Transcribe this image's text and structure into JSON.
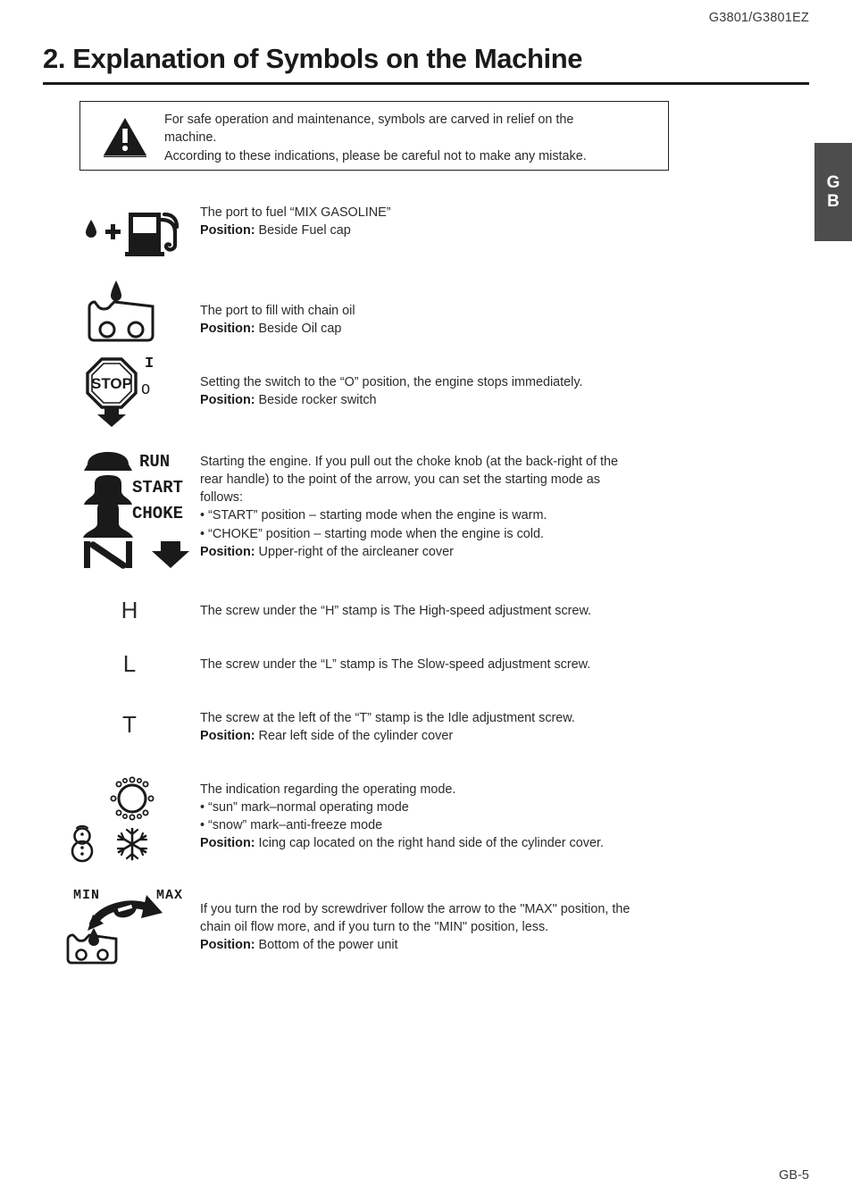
{
  "header": {
    "model_code": "G3801/G3801EZ",
    "title": "2. Explanation of Symbols on the Machine"
  },
  "side_tab": {
    "line1": "G",
    "line2": "B"
  },
  "note": {
    "icon": "warning-triangle-icon",
    "line1": "For safe operation and maintenance, symbols are carved in relief on the",
    "line2": "machine.",
    "line3": "According to these indications, please be careful not to make any mistake."
  },
  "rows": [
    {
      "icon": "fuel-pump-icon",
      "line1": "The port to fuel “MIX GASOLINE”",
      "position_label": "Position:",
      "position_value": " Beside Fuel cap"
    },
    {
      "icon": "chain-oil-icon",
      "line1": "The port to fill with chain oil",
      "position_label": "Position:",
      "position_value": " Beside Oil cap"
    },
    {
      "icon": "stop-switch-icon",
      "switch_on": "I",
      "switch_off": "O",
      "line1": "Setting the switch to the “O” position, the engine stops immediately.",
      "position_label": "Position:",
      "position_value": " Beside rocker switch"
    },
    {
      "icon": "choke-knob-icon",
      "knob_labels": [
        "RUN",
        "START",
        "CHOKE"
      ],
      "line1": "Starting the engine. If you pull out the choke knob (at the back-right of the",
      "line2": "rear handle) to the point of the arrow, you can set the starting mode as",
      "line3": "follows:",
      "bullet1": "• “START” position – starting mode when the engine is warm.",
      "bullet2": "• “CHOKE” position – starting mode when the engine is cold.",
      "position_label": "Position:",
      "position_value": " Upper-right of the aircleaner cover"
    },
    {
      "icon": "letter-h-stamp",
      "letter": "H",
      "line1": "The screw under the “H” stamp is The High-speed adjustment screw."
    },
    {
      "icon": "letter-l-stamp",
      "letter": "L",
      "line1": "The screw under the “L” stamp is The Slow-speed adjustment screw."
    },
    {
      "icon": "letter-t-stamp",
      "letter": "T",
      "line1": "The screw at the left of the “T” stamp is the Idle adjustment screw.",
      "position_label": "Position:",
      "position_value": " Rear left side of the cylinder cover"
    },
    {
      "icon": "sun-snow-icon",
      "line1": "The indication regarding the operating mode.",
      "bullet1": "• “sun” mark–normal operating mode",
      "bullet2": "• “snow” mark–anti-freeze mode",
      "position_label": "Position:",
      "position_value": " Icing cap located on the right hand side of the cylinder cover."
    },
    {
      "icon": "oil-flow-adjust-icon",
      "min_label": "MIN",
      "max_label": "MAX",
      "line1": "If you turn the rod by screwdriver follow the arrow to the \"MAX\" position, the",
      "line2": "chain oil flow more, and if you turn to the \"MIN\" position, less.",
      "position_label": "Position:",
      "position_value": " Bottom of the power unit"
    }
  ],
  "footer": {
    "page_number": "GB-5"
  },
  "colors": {
    "ink": "#231f20",
    "tab_background": "#4d4d4d",
    "tab_text": "#ffffff"
  }
}
